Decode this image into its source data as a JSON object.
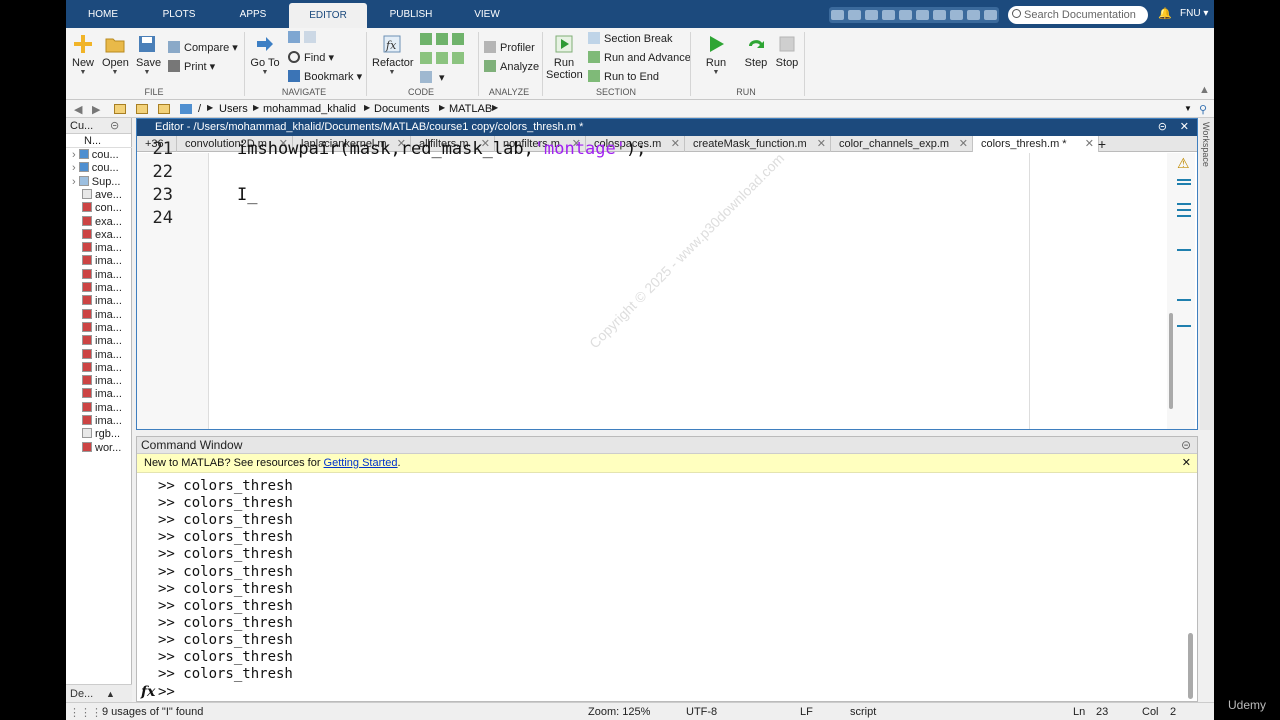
{
  "tabs": [
    "HOME",
    "PLOTS",
    "APPS",
    "EDITOR",
    "PUBLISH",
    "VIEW"
  ],
  "active_tab": "EDITOR",
  "search": {
    "placeholder": "Search Documentation"
  },
  "user": "FNU",
  "ribbon": {
    "file": {
      "group": "FILE",
      "new": "New",
      "open": "Open",
      "save": "Save",
      "compare": "Compare",
      "print": "Print"
    },
    "navigate": {
      "group": "NAVIGATE",
      "goto": "Go To",
      "find": "Find",
      "bookmark": "Bookmark"
    },
    "code": {
      "group": "CODE",
      "refactor": "Refactor"
    },
    "analyze": {
      "group": "ANALYZE",
      "profiler": "Profiler",
      "analyze": "Analyze"
    },
    "section": {
      "group": "SECTION",
      "run_section": "Run Section",
      "section_break": "Section Break",
      "run_advance": "Run and Advance",
      "run_end": "Run to End"
    },
    "run": {
      "group": "RUN",
      "run": "Run",
      "step": "Step",
      "stop": "Stop"
    }
  },
  "path": [
    "/",
    "Users",
    "mohammad_khalid",
    "Documents",
    "MATLAB"
  ],
  "current_folder": {
    "title": "Cu...",
    "header": "N...",
    "items": [
      "cou...",
      "cou...",
      "Sup...",
      "ave...",
      "con...",
      "exa...",
      "exa...",
      "ima...",
      "ima...",
      "ima...",
      "ima...",
      "ima...",
      "ima...",
      "ima...",
      "ima...",
      "ima...",
      "ima...",
      "ima...",
      "ima...",
      "ima...",
      "ima...",
      "rgb...",
      "wor..."
    ],
    "footer": "De..."
  },
  "editor": {
    "title": "Editor - /Users/mohammad_khalid/Documents/MATLAB/course1 copy/colors_thresh.m *",
    "hidden_count": "+36",
    "tabs": [
      "convolution2D.m",
      "laplaciankernel.m",
      "allfilters.m",
      "nonfilters.m",
      "colospaces.m",
      "createMask_function.m",
      "color_channels_exp.m",
      "colors_thresh.m *"
    ],
    "active_tab": "colors_thresh.m *",
    "lines": [
      {
        "num": "21",
        "pre": "imshowpair(mask,red_mask_lab,",
        "str": "'montage'",
        "post": ");"
      },
      {
        "num": "22",
        "pre": "",
        "str": "",
        "post": ""
      },
      {
        "num": "23",
        "pre": "I_",
        "str": "",
        "post": ""
      },
      {
        "num": "24",
        "pre": "",
        "str": "",
        "post": ""
      }
    ]
  },
  "workspace_label": "Workspace",
  "command": {
    "title": "Command Window",
    "banner_text": "New to MATLAB? See resources for",
    "banner_link": "Getting Started",
    "banner_end": ".",
    "history": [
      ">> colors_thresh",
      ">> colors_thresh",
      ">> colors_thresh",
      ">> colors_thresh",
      ">> colors_thresh",
      ">> colors_thresh",
      ">> colors_thresh",
      ">> colors_thresh",
      ">> colors_thresh",
      ">> colors_thresh",
      ">> colors_thresh",
      ">> colors_thresh"
    ],
    "fx": "fx",
    "prompt": ">>"
  },
  "status": {
    "message": "9 usages of \"I\" found",
    "zoom": "Zoom: 125%",
    "encoding": "UTF-8",
    "eol": "LF",
    "type": "script",
    "ln_label": "Ln",
    "ln": "23",
    "col_label": "Col",
    "col": "2"
  },
  "watermark": "Copyright © 2025 - www.p30download.com",
  "brand": "Udemy"
}
